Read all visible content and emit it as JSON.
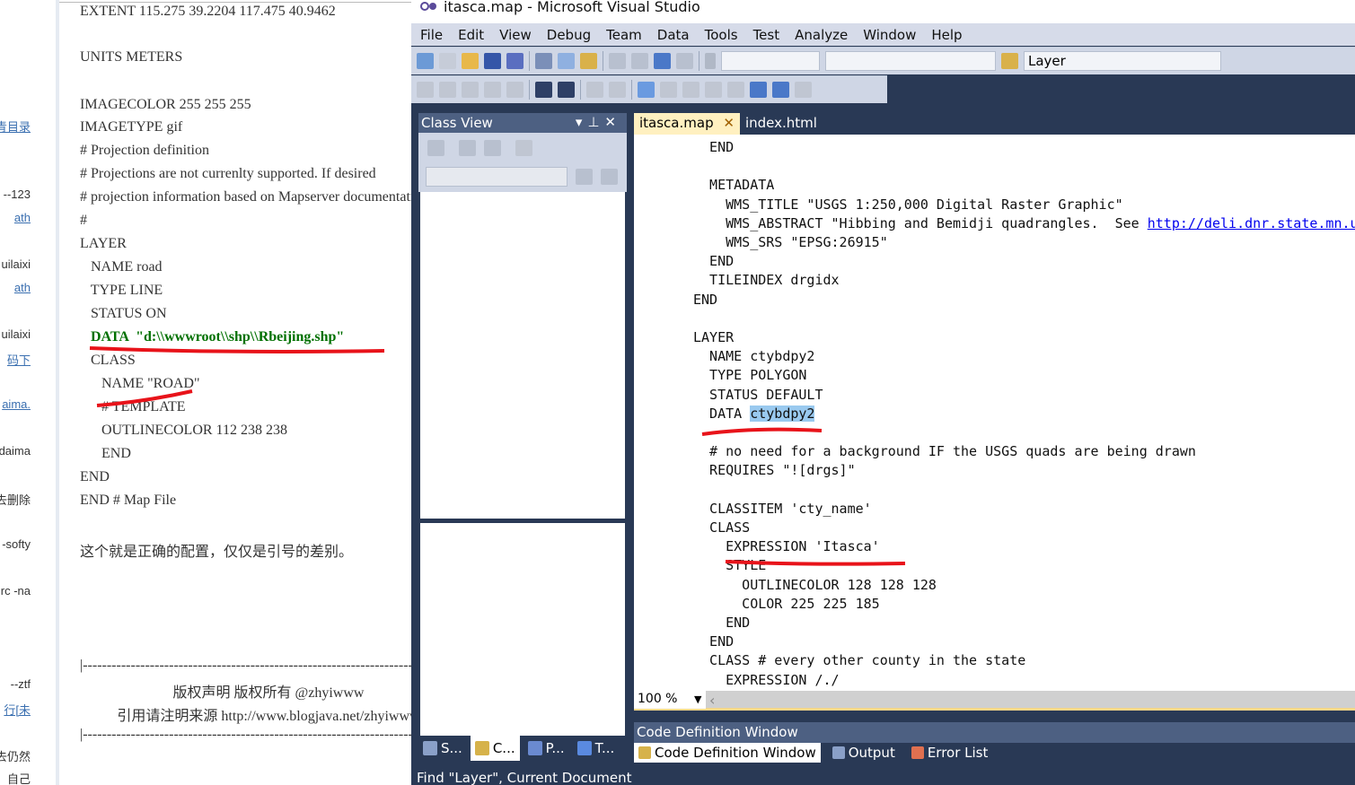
{
  "blog": {
    "sidebar_fragments": [
      {
        "text": "青目录",
        "link": true
      },
      {
        "text": "--123",
        "link": false
      },
      {
        "text": "ath",
        "link": true
      },
      {
        "text": "uilaixi",
        "link": false
      },
      {
        "text": "ath",
        "link": true
      },
      {
        "text": "uilaixi",
        "link": false
      },
      {
        "text": "码下",
        "link": true
      },
      {
        "text": "aima.",
        "link": true
      },
      {
        "text": "daima",
        "link": false
      },
      {
        "text": "去删除",
        "link": false
      },
      {
        "text": "-softy",
        "link": false
      },
      {
        "text": "rc -na",
        "link": false
      },
      {
        "text": "--ztf",
        "link": false
      },
      {
        "text": "行[未",
        "link": true
      },
      {
        "text": "去仍然",
        "link": false
      },
      {
        "text": "自己",
        "link": false
      }
    ],
    "lines": [
      "EXTENT 115.275 39.2204 117.475 40.9462",
      "UNITS METERS",
      "IMAGECOLOR 255 255 255",
      "IMAGETYPE gif",
      "# Projection definition",
      "# Projections are not currenlty supported. If desired",
      "# projection information based on Mapserver documentation",
      "#",
      "LAYER",
      " NAME road",
      " TYPE LINE",
      " STATUS ON",
      " DATA  \"d:\\\\wwwroot\\\\shp\\\\Rbeijing.shp\"",
      " CLASS",
      "  NAME \"ROAD\"",
      "  # TEMPLATE",
      "  OUTLINECOLOR 112 238 238",
      "  END",
      "END",
      "END # Map File",
      "这个就是正确的配置，仅仅是引号的差别。"
    ],
    "separator": "|----------------------------------------------------------------------------------------------------",
    "copyright": "版权声明  版权所有 @zhyiwww",
    "source": "引用请注明来源 http://www.blogjava.net/zhyiwww"
  },
  "vs": {
    "title": "itasca.map - Microsoft Visual Studio",
    "menu": [
      "File",
      "Edit",
      "View",
      "Debug",
      "Team",
      "Data",
      "Tools",
      "Test",
      "Analyze",
      "Window",
      "Help"
    ],
    "find_combo": "Layer",
    "class_view": {
      "title": "Class View",
      "tabs": [
        "S...",
        "C...",
        "P...",
        "T..."
      ]
    },
    "editor_tabs": [
      {
        "label": "itasca.map",
        "active": true
      },
      {
        "label": "index.html",
        "active": false
      }
    ],
    "code_lines": [
      {
        "t": "  END"
      },
      {
        "t": ""
      },
      {
        "t": "  METADATA"
      },
      {
        "t": "    WMS_TITLE \"USGS 1:250,000 Digital Raster Graphic\""
      },
      {
        "t": "    WMS_ABSTRACT \"Hibbing and Bemidji quadrangles.  See ",
        "link": "http://deli.dnr.state.mn.us"
      },
      {
        "t": "    WMS_SRS \"EPSG:26915\""
      },
      {
        "t": "  END"
      },
      {
        "t": "  TILEINDEX drgidx"
      },
      {
        "t": "END"
      },
      {
        "t": ""
      },
      {
        "t": "LAYER"
      },
      {
        "t": "  NAME ctybdpy2"
      },
      {
        "t": "  TYPE POLYGON"
      },
      {
        "t": "  STATUS DEFAULT"
      },
      {
        "t": "  DATA ",
        "sel": "ctybdpy2"
      },
      {
        "t": ""
      },
      {
        "t": "  # no need for a background IF the USGS quads are being drawn"
      },
      {
        "t": "  REQUIRES \"![drgs]\""
      },
      {
        "t": ""
      },
      {
        "t": "  CLASSITEM 'cty_name'"
      },
      {
        "t": "  CLASS"
      },
      {
        "t": "    EXPRESSION 'Itasca'"
      },
      {
        "t": "    STYLE"
      },
      {
        "t": "      OUTLINECOLOR 128 128 128"
      },
      {
        "t": "      COLOR 225 225 185"
      },
      {
        "t": "    END"
      },
      {
        "t": "  END"
      },
      {
        "t": "  CLASS # every other county in the state"
      },
      {
        "t": "    EXPRESSION /./"
      }
    ],
    "zoom_level": "100 %",
    "code_definition": {
      "title": "Code Definition Window",
      "tabs": [
        "Code Definition Window",
        "Output",
        "Error List"
      ]
    },
    "status": "Find \"Layer\", Current Document"
  }
}
